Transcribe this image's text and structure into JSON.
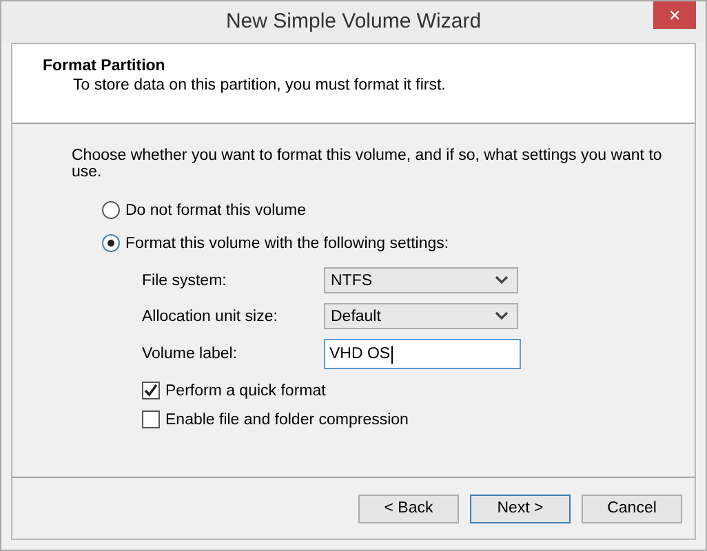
{
  "window": {
    "title": "New Simple Volume Wizard",
    "close": "✕"
  },
  "header": {
    "title": "Format Partition",
    "subtitle": "To store data on this partition, you must format it first."
  },
  "intro": "Choose whether you want to format this volume, and if so, what settings you want to use.",
  "options": [
    {
      "label": "Do not format this volume",
      "selected": false
    },
    {
      "label": "Format this volume with the following settings:",
      "selected": true
    }
  ],
  "settings": [
    {
      "kind": "dropdown",
      "label": "File system:",
      "value": "NTFS"
    },
    {
      "kind": "dropdown",
      "label": "Allocation unit size:",
      "value": "Default"
    },
    {
      "kind": "text",
      "label": "Volume label:",
      "value": "VHD OS"
    }
  ],
  "checkboxes": [
    {
      "label": "Perform a quick format",
      "checked": true
    },
    {
      "label": "Enable file and folder compression",
      "checked": false
    }
  ],
  "buttons": [
    {
      "label": "< Back",
      "focused": false
    },
    {
      "label": "Next >",
      "focused": true
    },
    {
      "label": "Cancel",
      "focused": false
    }
  ]
}
